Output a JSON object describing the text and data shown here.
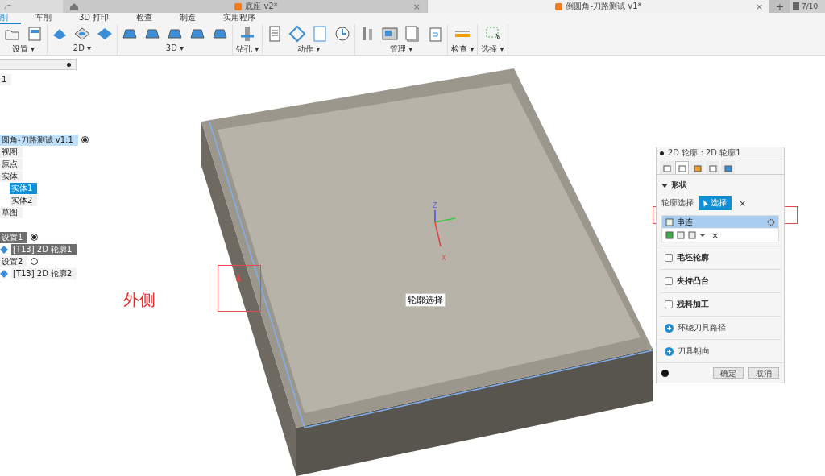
{
  "doc_tabs": [
    {
      "title": "底座 v2*",
      "selected": false,
      "close": "×"
    },
    {
      "title": "倒圆角-刀路测试 v1*",
      "selected": true,
      "close": "×"
    }
  ],
  "new_tab": "+",
  "job_count": "7/10",
  "ribbon_tabs": [
    {
      "label": "削",
      "selected": true
    },
    {
      "label": "车削",
      "selected": false
    },
    {
      "label": "3D 打印",
      "selected": false
    },
    {
      "label": "检查",
      "selected": false
    },
    {
      "label": "制造",
      "selected": false
    },
    {
      "label": "实用程序",
      "selected": false
    }
  ],
  "toolbar_groups": [
    {
      "label": "设置 ▾"
    },
    {
      "label": "2D ▾"
    },
    {
      "label": "3D ▾"
    },
    {
      "label": "钻孔 ▾"
    },
    {
      "label": "动作 ▾"
    },
    {
      "label": "管理 ▾"
    },
    {
      "label": "检查 ▾"
    },
    {
      "label": "选择 ▾"
    }
  ],
  "browser": {
    "top_item": "1",
    "component": {
      "label": "圆角-刀路测试 v1:1",
      "highlighted": true,
      "current": true,
      "children": [
        {
          "label": "视图",
          "selected": false
        },
        {
          "label": "原点",
          "selected": false
        },
        {
          "label": "实体",
          "selected": false,
          "children": [
            {
              "label": "实体1",
              "selected": true
            },
            {
              "label": "实体2",
              "selected": false
            }
          ]
        },
        {
          "label": "草图",
          "selected": false
        }
      ]
    },
    "setups": [
      {
        "label": "设置1",
        "active": true,
        "current": true,
        "children": [
          {
            "label": "[T13] 2D 轮廓1",
            "active": true
          }
        ]
      },
      {
        "label": "设置2",
        "active": false,
        "current": false,
        "children": [
          {
            "label": "[T13] 2D 轮廓2",
            "active": false
          }
        ]
      }
    ]
  },
  "viewport": {
    "axis_z": "Z",
    "axis_x": "X",
    "tooltip": "轮廓选择",
    "annotation": "外侧"
  },
  "dialog": {
    "title": "2D 轮廓 : 2D 轮廓1",
    "tabs": [
      {
        "selected": false
      },
      {
        "selected": true
      },
      {
        "selected": false
      },
      {
        "selected": false
      },
      {
        "selected": false
      }
    ],
    "section": "形状",
    "expanded": true,
    "field_label": "轮廓选择",
    "select_button": "选择",
    "clear": "×",
    "selection_rows": [
      {
        "label": "串连",
        "selected": true
      }
    ],
    "row_clear": "×",
    "options": [
      {
        "kind": "checkbox",
        "label": "毛坯轮廓",
        "checked": false
      },
      {
        "kind": "checkbox",
        "label": "夹持凸台",
        "checked": false
      },
      {
        "kind": "checkbox",
        "label": "残料加工",
        "checked": false
      },
      {
        "kind": "group",
        "label": "环绕刀具路径"
      },
      {
        "kind": "group",
        "label": "刀具朝向"
      }
    ],
    "buttons": [
      "确定",
      "取消"
    ]
  }
}
